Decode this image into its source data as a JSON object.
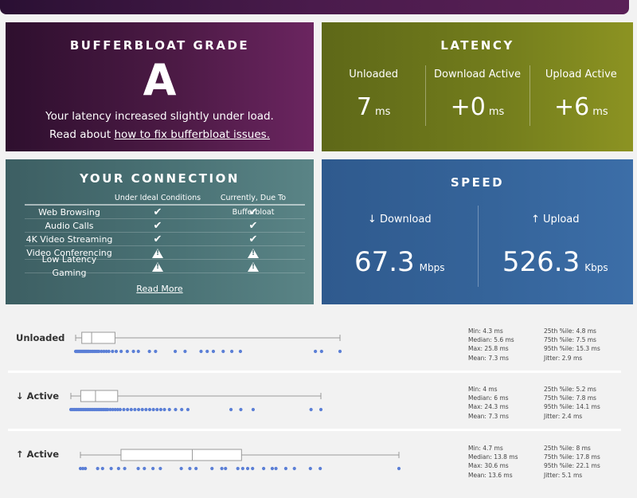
{
  "grade": {
    "title": "BUFFERBLOAT GRADE",
    "letter": "A",
    "description": "Your latency increased slightly under load.",
    "read_prefix": "Read about ",
    "read_link": "how to fix bufferbloat issues."
  },
  "latency": {
    "title": "LATENCY",
    "columns": [
      {
        "label": "Unloaded",
        "value": "7",
        "unit": "ms"
      },
      {
        "label": "Download Active",
        "value": "+0",
        "unit": "ms"
      },
      {
        "label": "Upload Active",
        "value": "+6",
        "unit": "ms"
      }
    ]
  },
  "connection": {
    "title": "YOUR CONNECTION",
    "headers": [
      "Under Ideal Conditions",
      "Currently, Due To Bufferbloat"
    ],
    "rows": [
      {
        "label": "Web Browsing",
        "ideal": "check",
        "current": "check"
      },
      {
        "label": "Audio Calls",
        "ideal": "check",
        "current": "check"
      },
      {
        "label": "4K Video Streaming",
        "ideal": "check",
        "current": "check"
      },
      {
        "label": "Video Conferencing",
        "ideal": "warning",
        "current": "warning"
      },
      {
        "label": "Low Latency Gaming",
        "ideal": "warning",
        "current": "warning"
      }
    ],
    "read_more": "Read More"
  },
  "speed": {
    "title": "SPEED",
    "download_label": "↓ Download",
    "download_value": "67.3",
    "download_unit": "Mbps",
    "upload_label": "↑ Upload",
    "upload_value": "526.3",
    "upload_unit": "Kbps"
  },
  "distributions": [
    {
      "name": "Unloaded",
      "box": {
        "min": 4.3,
        "q1": 4.8,
        "median": 5.6,
        "q3": 7.5,
        "max": 25.8
      },
      "points": [
        4.3,
        4.35,
        4.4,
        4.45,
        4.5,
        4.55,
        4.6,
        4.65,
        4.7,
        4.75,
        4.8,
        4.85,
        4.9,
        4.95,
        5.0,
        5.05,
        5.1,
        5.15,
        5.2,
        5.25,
        5.3,
        5.35,
        5.4,
        5.5,
        5.6,
        5.7,
        5.8,
        5.9,
        6.0,
        6.1,
        6.2,
        6.4,
        6.6,
        6.8,
        7.0,
        7.3,
        7.6,
        8.0,
        8.5,
        9.0,
        9.4,
        10.3,
        10.8,
        12.4,
        13.2,
        14.5,
        15.0,
        15.5,
        16.3,
        17.0,
        17.7,
        23.8,
        24.3,
        25.8
      ],
      "stats_left": [
        "Min: 4.3 ms",
        "Median: 5.6 ms",
        "Max: 25.8 ms",
        "Mean: 7.3 ms"
      ],
      "stats_right": [
        "25th %ile: 4.8 ms",
        "75th %ile: 7.5 ms",
        "95th %ile: 15.3 ms",
        "Jitter: 2.9 ms"
      ]
    },
    {
      "name": "↓ Active",
      "box": {
        "min": 4,
        "q1": 4.8,
        "median": 6,
        "q3": 7.8,
        "max": 24.3
      },
      "points": [
        4.0,
        4.1,
        4.2,
        4.3,
        4.4,
        4.5,
        4.6,
        4.7,
        4.8,
        4.9,
        5.0,
        5.1,
        5.2,
        5.3,
        5.4,
        5.5,
        5.6,
        5.7,
        5.8,
        5.9,
        6.0,
        6.1,
        6.2,
        6.3,
        6.4,
        6.5,
        6.6,
        6.7,
        6.8,
        6.9,
        7.0,
        7.2,
        7.4,
        7.6,
        7.8,
        8.0,
        8.3,
        8.6,
        8.9,
        9.2,
        9.5,
        9.8,
        10.1,
        10.4,
        10.7,
        11.0,
        11.3,
        11.6,
        12.0,
        12.5,
        13.0,
        13.5,
        17.0,
        17.8,
        18.8,
        23.5,
        24.3
      ],
      "stats_left": [
        "Min: 4 ms",
        "Median: 6 ms",
        "Max: 24.3 ms",
        "Mean: 7.3 ms"
      ],
      "stats_right": [
        "25th %ile: 5.2 ms",
        "75th %ile: 7.8 ms",
        "95th %ile: 14.1 ms",
        "Jitter: 2.4 ms"
      ]
    },
    {
      "name": "↑ Active",
      "box": {
        "min": 4.7,
        "q1": 8,
        "median": 13.8,
        "q3": 17.8,
        "max": 30.6
      },
      "points": [
        4.7,
        4.9,
        5.1,
        6.1,
        6.5,
        7.2,
        7.8,
        8.3,
        9.4,
        9.9,
        10.6,
        11.2,
        12.9,
        13.6,
        14.1,
        15.4,
        16.2,
        16.5,
        17.5,
        17.9,
        18.3,
        18.7,
        19.6,
        20.3,
        20.6,
        21.4,
        22.1,
        23.4,
        24.2,
        30.6
      ],
      "stats_left": [
        "Min: 4.7 ms",
        "Median: 13.8 ms",
        "Max: 30.6 ms",
        "Mean: 13.6 ms"
      ],
      "stats_right": [
        "25th %ile: 8 ms",
        "75th %ile: 17.8 ms",
        "95th %ile: 22.1 ms",
        "Jitter: 5.1 ms"
      ]
    }
  ],
  "colors": {
    "dot": "#5b7fd6",
    "box_stroke": "#999999"
  }
}
